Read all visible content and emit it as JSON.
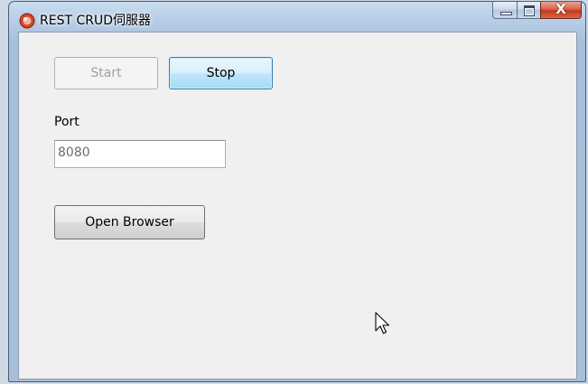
{
  "window": {
    "title": "REST CRUD伺服器"
  },
  "buttons": {
    "start_label": "Start",
    "stop_label": "Stop",
    "open_browser_label": "Open Browser"
  },
  "port": {
    "label": "Port",
    "value": "8080"
  },
  "caption_buttons": {
    "close_glyph": "X"
  },
  "colors": {
    "client_bg": "#f0f0f0",
    "titlebar": "#b7cde5",
    "close_button": "#c0391f"
  }
}
